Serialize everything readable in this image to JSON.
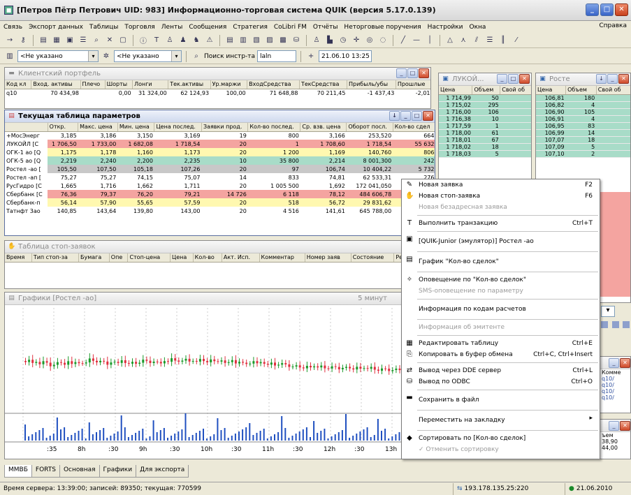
{
  "window": {
    "title": "[Петров Пётр Петрович  UID: 983] Информационно-торговая система QUIK (версия 5.17.0.139)"
  },
  "menu": [
    "Связь",
    "Экспорт данных",
    "Таблицы",
    "Торговля",
    "Ленты",
    "Сообщения",
    "Стратегия",
    "CoLibri FM",
    "Отчёты",
    "Неторговые поручения",
    "Настройки",
    "Окна"
  ],
  "menu_right": "Справка",
  "toolbar2": {
    "combo1": "<Не указано",
    "combo2": "<Не указано",
    "search_label": "Поиск инстр-та",
    "search_value": "laln",
    "datetime": "21.06.10 13:25"
  },
  "portfolio": {
    "title": "Клиентский портфель",
    "headers": [
      "Код кл",
      "Вход. активы",
      "Плечо",
      "Шорты",
      "Лонги",
      "Тек.активы",
      "Ур.маржи",
      "ВходСредства",
      "ТекСредства",
      "Прибыль/убы",
      "Прошлые"
    ],
    "row": [
      "q10",
      "70 434,98",
      "",
      "0,00",
      "31 324,00",
      "62 124,93",
      "100,00",
      "71 648,88",
      "70 211,45",
      "-1 437,43",
      "-2,01"
    ]
  },
  "params": {
    "title": "Текущая таблица параметров",
    "headers": [
      "",
      "Откр.",
      "Макс. цена",
      "Мин. цена",
      "Цена послед.",
      "Заявки прод.",
      "Кол-во послед.",
      "Ср. взв. цена",
      "Оборот посл.",
      "Кол-во сдел"
    ],
    "rows": [
      {
        "c": "r-wht",
        "v": [
          "+МосЭнерг",
          "3,185",
          "3,186",
          "3,150",
          "3,169",
          "19",
          "800",
          "3,166",
          "253,520",
          "664"
        ]
      },
      {
        "c": "r-red",
        "v": [
          "ЛУКОЙЛ [С",
          "1 706,50",
          "1 733,00",
          "1 682,08",
          "1 718,54",
          "20",
          "1",
          "1 708,60",
          "1 718,54",
          "55 632"
        ]
      },
      {
        "c": "r-yel",
        "v": [
          "ОГК-1 ао [Q",
          "1,175",
          "1,178",
          "1,160",
          "1,173",
          "20",
          "1 200",
          "1,169",
          "140,760",
          "806"
        ]
      },
      {
        "c": "r-grn",
        "v": [
          "ОГК-5 ао [Q",
          "2,219",
          "2,240",
          "2,200",
          "2,235",
          "10",
          "35 800",
          "2,214",
          "8 001,300",
          "242"
        ]
      },
      {
        "c": "r-gry",
        "v": [
          "Ростел -ао [",
          "105,50",
          "107,50",
          "105,18",
          "107,26",
          "20",
          "97",
          "106,74",
          "10 404,22",
          "5 732"
        ]
      },
      {
        "c": "r-wht",
        "v": [
          "Ростел -ап [",
          "75,27",
          "75,27",
          "74,15",
          "75,07",
          "14",
          "833",
          "74,81",
          "62 533,31",
          "276"
        ]
      },
      {
        "c": "r-wht",
        "v": [
          "РусГидро [С",
          "1,665",
          "1,716",
          "1,662",
          "1,711",
          "20",
          "1 005 500",
          "1,692",
          "172 041,050",
          "5 128"
        ]
      },
      {
        "c": "r-red",
        "v": [
          "Сбербанк [С",
          "76,36",
          "79,37",
          "76,20",
          "79,21",
          "14 726",
          "6 118",
          "78,12",
          "484 606,78",
          "3 911"
        ]
      },
      {
        "c": "r-yel",
        "v": [
          "Сбербанк-п",
          "56,14",
          "57,90",
          "55,65",
          "57,59",
          "20",
          "518",
          "56,72",
          "29 831,62",
          "186"
        ]
      },
      {
        "c": "r-wht",
        "v": [
          "Татнфт 3ао",
          "140,85",
          "143,64",
          "139,80",
          "143,00",
          "20",
          "4 516",
          "141,61",
          "645 788,00",
          "1 240"
        ]
      }
    ]
  },
  "stops": {
    "title": "Таблица стоп-заявок",
    "headers": [
      "Время",
      "Тип стоп-за",
      "Бумага",
      "Опе",
      "Стоп-цена",
      "Цена",
      "Кол-во",
      "Акт. Исп.",
      "Комментар",
      "Номер заяв",
      "Состояние",
      "Результа"
    ]
  },
  "chart": {
    "title": "Графики [Ростел -ао]",
    "interval": "5 минут",
    "times": [
      ":35",
      "8h",
      ":30",
      "9h",
      ":30",
      "10h",
      ":30",
      "11h",
      ":30",
      "12h",
      ":30",
      "13h",
      ":30"
    ]
  },
  "lukoil": {
    "title": "ЛУКОЙ...",
    "headers": [
      "Цена",
      "Объем",
      "Свой об"
    ],
    "rows": [
      [
        "1 714,99",
        "50"
      ],
      [
        "1 715,02",
        "295"
      ],
      [
        "1 716,00",
        "106"
      ],
      [
        "1 716,38",
        "10"
      ],
      [
        "1 717,59",
        "1"
      ],
      [
        "1 718,00",
        "61"
      ],
      [
        "1 718,01",
        "67"
      ],
      [
        "1 718,02",
        "18"
      ],
      [
        "1 718,03",
        "5"
      ]
    ]
  },
  "rostel": {
    "title": "Росте",
    "headers": [
      "Цена",
      "Объем",
      "Свой об"
    ],
    "rows": [
      [
        "106,81",
        "180"
      ],
      [
        "106,82",
        "4"
      ],
      [
        "106,90",
        "105"
      ],
      [
        "106,91",
        "4"
      ],
      [
        "106,95",
        "83"
      ],
      [
        "106,99",
        "14"
      ],
      [
        "107,07",
        "18"
      ],
      [
        "107,09",
        "5"
      ],
      [
        "107,10",
        "2"
      ]
    ]
  },
  "right_lower": {
    "header": "Комме",
    "vals": [
      "q10/",
      "q10/",
      "q10/",
      "q10/"
    ]
  },
  "right_lower2": {
    "header": "ъем",
    "vals": [
      "38,90",
      "44,00"
    ]
  },
  "context_menu": [
    {
      "t": "item",
      "icon": "✎",
      "label": "Новая заявка",
      "sc": "F2"
    },
    {
      "t": "item",
      "icon": "✋",
      "label": "Новая стоп-заявка",
      "sc": "F6"
    },
    {
      "t": "dis",
      "label": "Новая безадресная заявка"
    },
    {
      "t": "sep"
    },
    {
      "t": "item",
      "icon": "T",
      "label": "Выполнить транзакцию",
      "sc": "Ctrl+T"
    },
    {
      "t": "sep"
    },
    {
      "t": "big",
      "icon": "▣",
      "label": "[QUIK-Junior (эмулятор)] Ростел -ао"
    },
    {
      "t": "sep"
    },
    {
      "t": "big",
      "icon": "▤",
      "label": "График \"Кол-во сделок\""
    },
    {
      "t": "sep"
    },
    {
      "t": "item",
      "icon": "✧",
      "label": "Оповещение по \"Кол-во сделок\""
    },
    {
      "t": "dis",
      "label": "SMS-оповещение по параметру"
    },
    {
      "t": "sep"
    },
    {
      "t": "big",
      "icon": "",
      "label": "Информация по кодам расчетов"
    },
    {
      "t": "sep"
    },
    {
      "t": "dis",
      "label": "Информация об эмитенте"
    },
    {
      "t": "sep"
    },
    {
      "t": "item",
      "icon": "▦",
      "label": "Редактировать таблицу",
      "sc": "Ctrl+E"
    },
    {
      "t": "item",
      "icon": "⎘",
      "label": "Копировать в буфер обмена",
      "sc": "Ctrl+C, Ctrl+Insert"
    },
    {
      "t": "sep"
    },
    {
      "t": "item",
      "icon": "⇄",
      "label": "Вывод через DDE сервер",
      "sc": "Ctrl+L"
    },
    {
      "t": "item",
      "icon": "⛁",
      "label": "Вывод по ODBC",
      "sc": "Ctrl+O"
    },
    {
      "t": "sep"
    },
    {
      "t": "big",
      "icon": "▬",
      "label": "Сохранить в файл"
    },
    {
      "t": "sep"
    },
    {
      "t": "sub",
      "icon": "",
      "label": "Переместить на закладку",
      "sc": "▸"
    },
    {
      "t": "sep"
    },
    {
      "t": "item",
      "icon": "◆",
      "label": "Сортировать по [Кол-во сделок]"
    },
    {
      "t": "dis",
      "label": "✓ Отменить сортировку"
    }
  ],
  "tabs": [
    "ММВБ",
    "FORTS",
    "Основная",
    "Графики",
    "Для экспорта"
  ],
  "status": {
    "server": "Время сервера: 13:39:00; записей: 89350; текущая: 770599",
    "ip": "193.178.135.25:220",
    "date": "21.06.2010"
  }
}
